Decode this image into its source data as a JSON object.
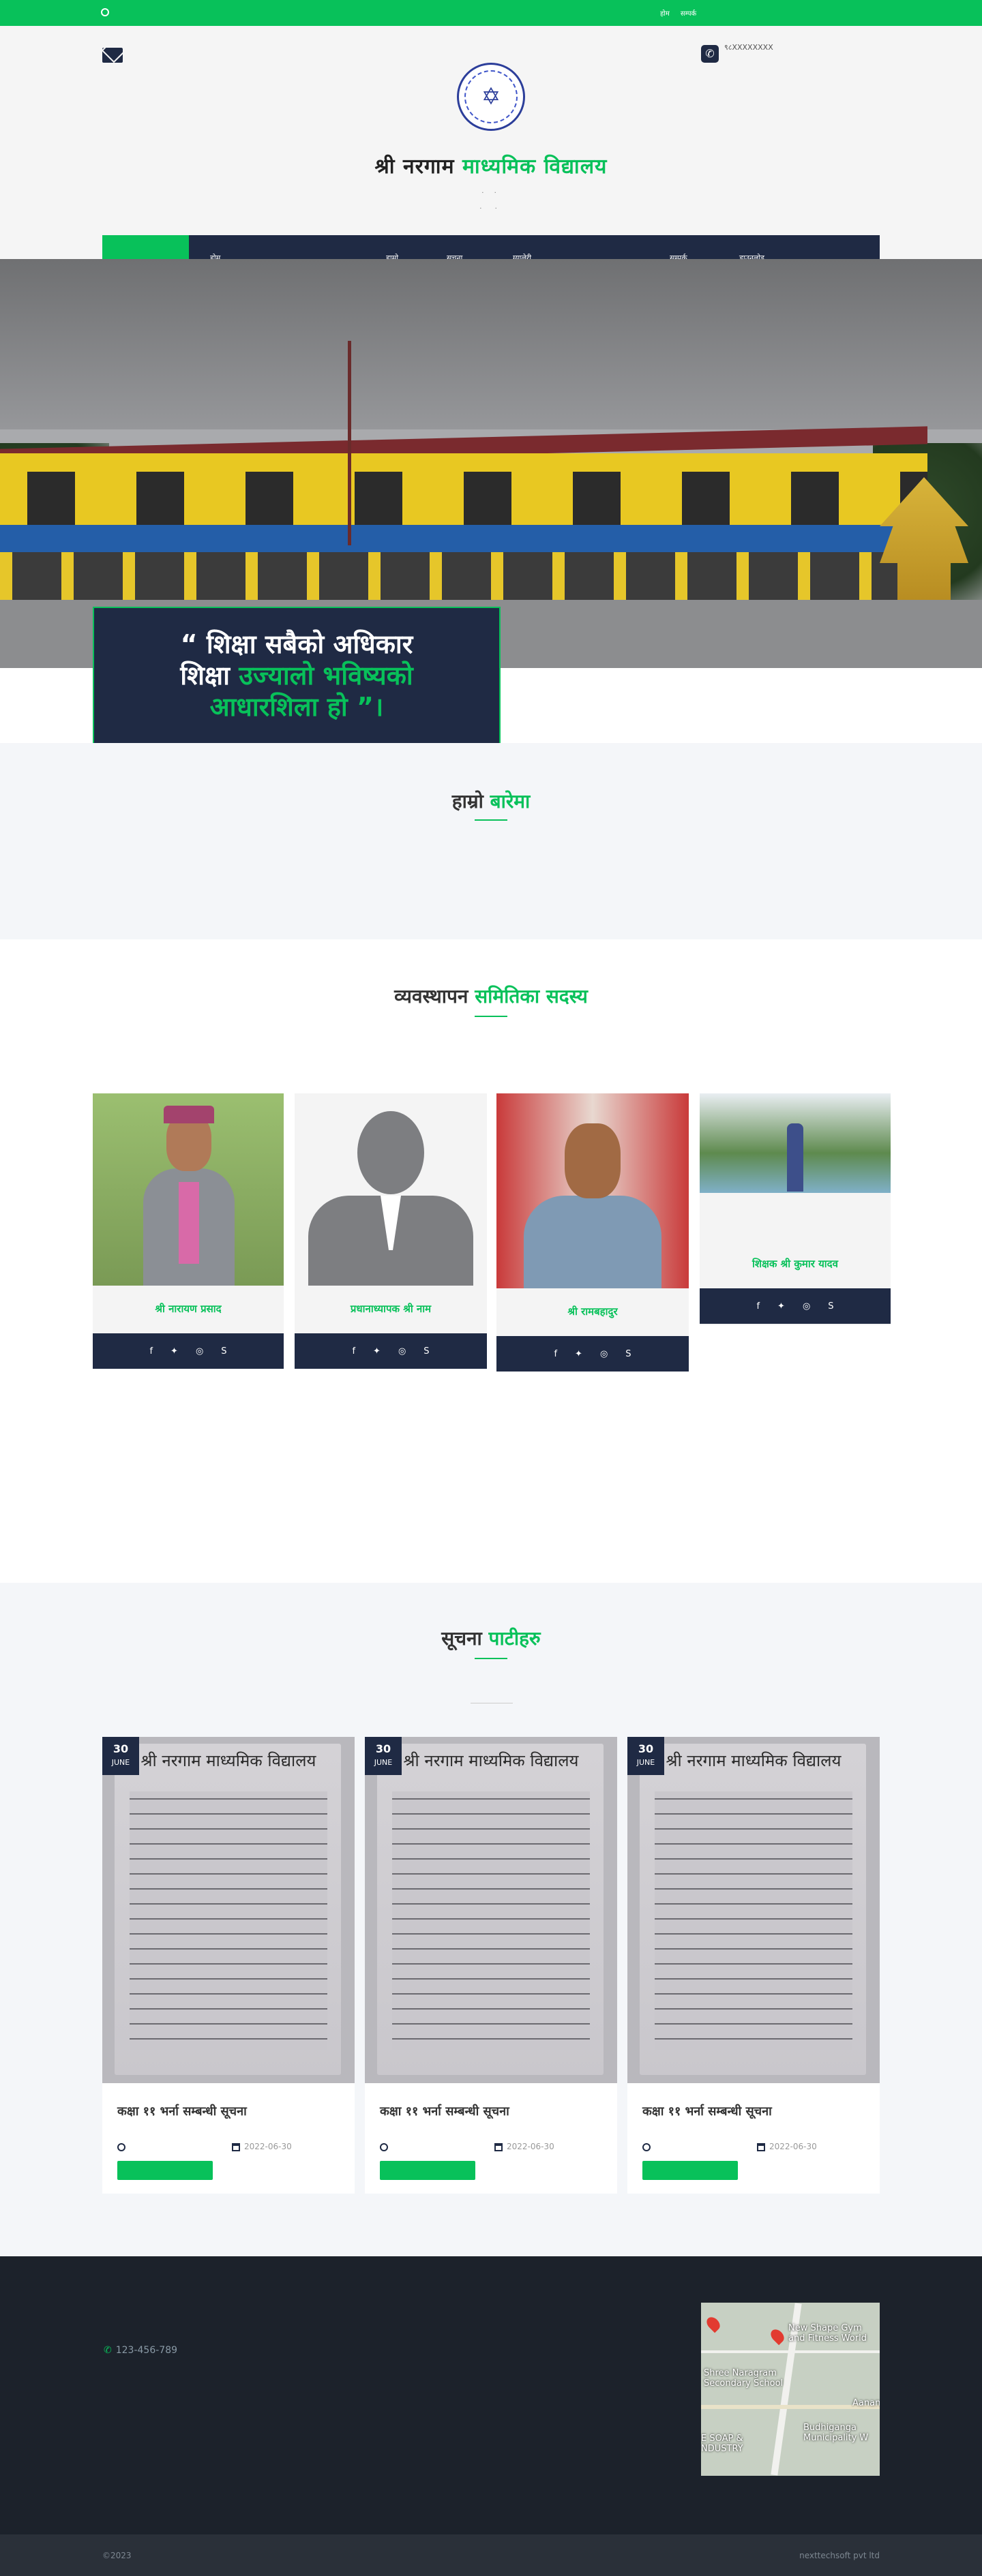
{
  "topbar": {
    "links": [
      "होम",
      "सम्पर्क"
    ]
  },
  "header": {
    "phone_text": "९८XXXXXXXX",
    "school_name_part1": "श्री नरगाम",
    "school_name_part2": "माध्यमिक विद्यालय",
    "sub_line1": ". .",
    "sub_line2": ". ."
  },
  "nav": {
    "items": [
      "होम",
      "हाम्रो",
      "सूचना",
      "ग्यालेरी",
      "सम्पर्क",
      "डाउनलोड"
    ]
  },
  "hero": {
    "quote_line1": "“ शिक्षा सबैको अधिकार",
    "quote_line2a": "शिक्षा ",
    "quote_line2b": "उज्यालो भविष्यको",
    "quote_line3": "आधारशिला हो ”।"
  },
  "about": {
    "title_a": "हाम्रो ",
    "title_b": "बारेमा"
  },
  "team": {
    "title_a": "व्यवस्थापन ",
    "title_b": "समितिका सदस्य",
    "members": [
      {
        "name": "श्री नारायण प्रसाद"
      },
      {
        "name": "प्रधानाध्यापक श्री नाम"
      },
      {
        "name": "श्री रामबहादुर"
      },
      {
        "name": "शिक्षक श्री कुमार यादव"
      }
    ]
  },
  "notices": {
    "title_a": "सूचना ",
    "title_b": "पाटीहरु",
    "items": [
      {
        "day": "30",
        "month": "JUNE",
        "title": "कक्षा ११ भर्ना सम्बन्धी सूचना",
        "date": "2022-06-30"
      },
      {
        "day": "30",
        "month": "JUNE",
        "title": "कक्षा ११ भर्ना सम्बन्धी सूचना",
        "date": "2022-06-30"
      },
      {
        "day": "30",
        "month": "JUNE",
        "title": "कक्षा ११ भर्ना सम्बन्धी सूचना",
        "date": "2022-06-30"
      }
    ],
    "doc_title": "श्री नरगाम माध्यमिक विद्यालय"
  },
  "footer": {
    "phone": "123-456-789",
    "map_labels": [
      "New Shape Gym and Fitness World",
      "Shree Naragram Secondary School",
      "Aanan",
      "Budhiganga Municipality W",
      "E SOAP & NDUSTRY"
    ]
  },
  "bottom": {
    "left": "©2023",
    "right": "nexttechsoft pvt ltd"
  },
  "colors": {
    "accent": "#08c15a",
    "navy": "#1f2a44",
    "footer": "#1c222b"
  }
}
